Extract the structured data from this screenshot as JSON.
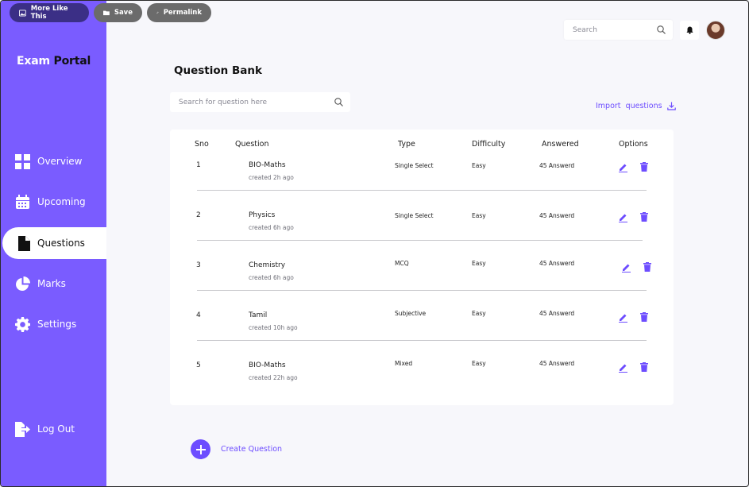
{
  "toolbar": {
    "more_like_this": "More Like This",
    "save": "Save",
    "permalink": "Permalink"
  },
  "brand": {
    "part1": "Exam",
    "part2": "Portal"
  },
  "sidebar": {
    "items": [
      {
        "label": "Overview",
        "icon": "grid-icon"
      },
      {
        "label": "Upcoming",
        "icon": "calendar-icon"
      },
      {
        "label": "Questions",
        "icon": "document-icon",
        "active": true
      },
      {
        "label": "Marks",
        "icon": "pie-chart-icon"
      },
      {
        "label": "Settings",
        "icon": "gear-icon"
      }
    ],
    "logout": "Log Out"
  },
  "header": {
    "search_placeholder": "Search"
  },
  "page": {
    "title": "Question Bank",
    "search_placeholder": "Search for question here",
    "import_label": "Import  questions",
    "create_label": "Create Question"
  },
  "table": {
    "headers": [
      "Sno",
      "Question",
      "Type",
      "Difficulty",
      "Answered",
      "Options"
    ],
    "rows": [
      {
        "sno": "1",
        "question": "BIO-Maths",
        "created": "created 2h ago",
        "type": "Single Select",
        "difficulty": "Easy",
        "answered": "45 Answerd"
      },
      {
        "sno": "2",
        "question": "Physics",
        "created": "created 6h ago",
        "type": "Single Select",
        "difficulty": "Easy",
        "answered": "45 Answerd"
      },
      {
        "sno": "3",
        "question": "Chemistry",
        "created": "created 6h ago",
        "type": "MCQ",
        "difficulty": "Easy",
        "answered": "45 Answerd"
      },
      {
        "sno": "4",
        "question": "Tamil",
        "created": "created 10h ago",
        "type": "Subjective",
        "difficulty": "Easy",
        "answered": "45 Answerd"
      },
      {
        "sno": "5",
        "question": "BIO-Maths",
        "created": "created 22h ago",
        "type": "Mixed",
        "difficulty": "Easy",
        "answered": "45 Answerd"
      }
    ]
  },
  "colors": {
    "accent": "#7a5cff",
    "accent_dark": "#6d4dff",
    "pill_dark": "#3b2f86",
    "pill_gray": "#6b6b6b"
  }
}
